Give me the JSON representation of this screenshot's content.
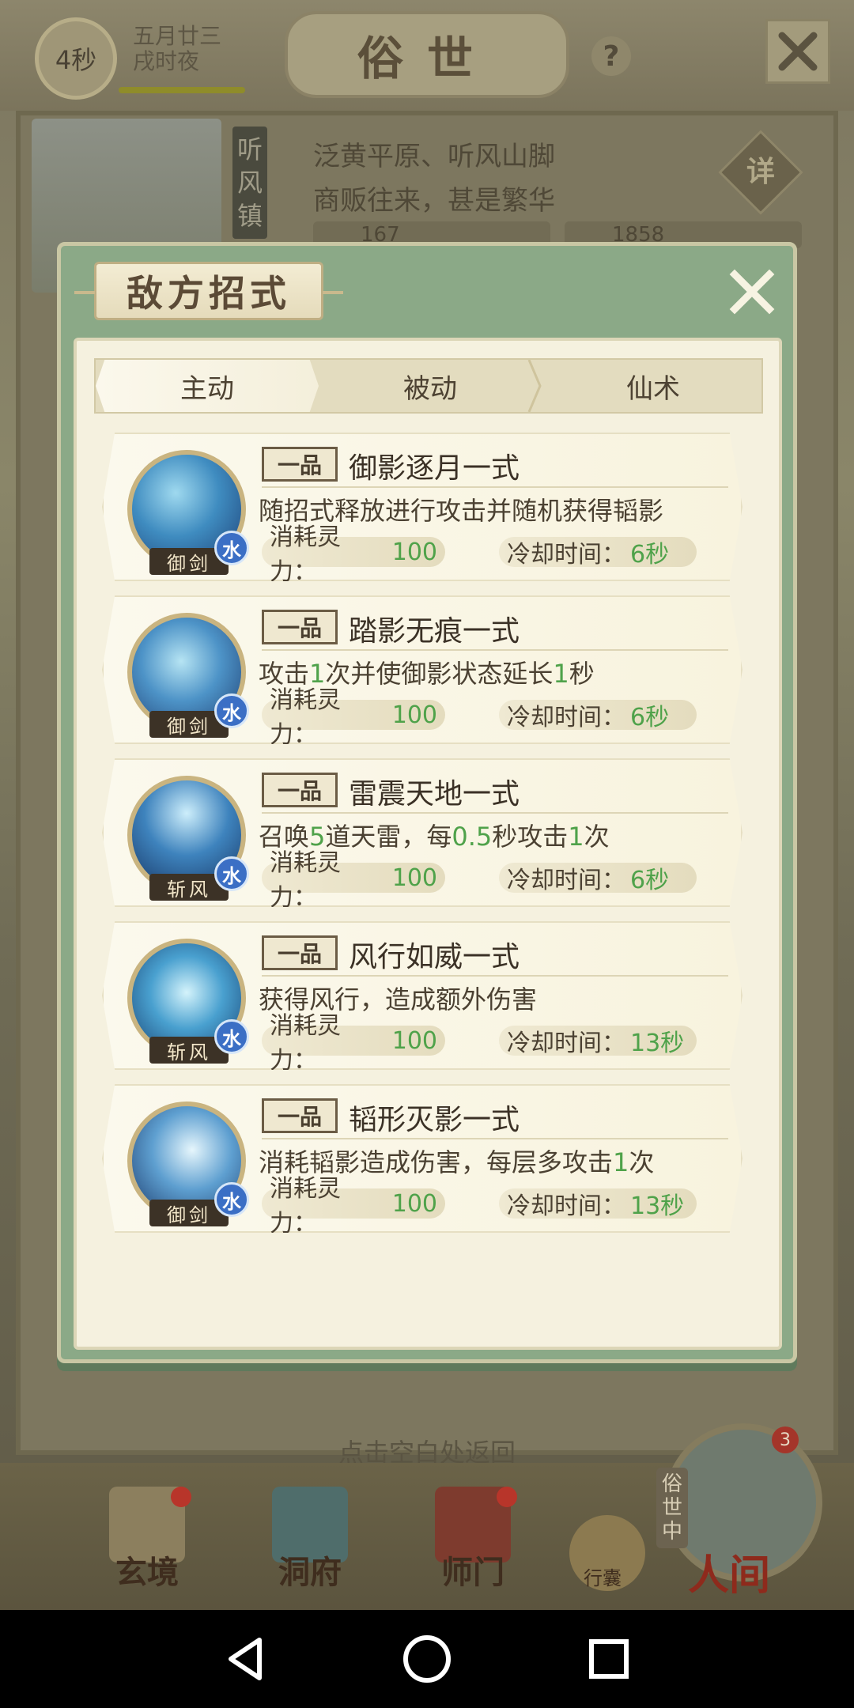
{
  "header": {
    "timer": "4秒",
    "date_line1": "五月廿三",
    "date_line2": "戌时夜",
    "title": "俗世",
    "help": "?"
  },
  "town": {
    "name": "听风镇",
    "desc_line1": "泛黄平原、听风山脚",
    "desc_line2": "商贩往来，甚是繁华",
    "detail": "详",
    "stat1": "167",
    "stat2": "1858"
  },
  "modal": {
    "title": "敌方招式",
    "tabs": [
      {
        "label": "主动",
        "active": true
      },
      {
        "label": "被动",
        "active": false
      },
      {
        "label": "仙术",
        "active": false
      }
    ],
    "cost_label": "消耗灵力：",
    "cd_label": "冷却时间：",
    "skills": [
      {
        "grade": "一品",
        "name": "御影逐月一式",
        "desc": [
          {
            "t": "随招式释放进行攻击并随机获得韬影",
            "n": false
          }
        ],
        "element": "水",
        "type": "御剑",
        "cost": "100",
        "cooldown": "6秒"
      },
      {
        "grade": "一品",
        "name": "踏影无痕一式",
        "desc": [
          {
            "t": "攻击",
            "n": false
          },
          {
            "t": "1",
            "n": true
          },
          {
            "t": "次并使御影状态延长",
            "n": false
          },
          {
            "t": "1",
            "n": true
          },
          {
            "t": "秒",
            "n": false
          }
        ],
        "element": "水",
        "type": "御剑",
        "cost": "100",
        "cooldown": "6秒"
      },
      {
        "grade": "一品",
        "name": "雷震天地一式",
        "desc": [
          {
            "t": "召唤",
            "n": false
          },
          {
            "t": "5",
            "n": true
          },
          {
            "t": "道天雷，每",
            "n": false
          },
          {
            "t": "0.5",
            "n": true
          },
          {
            "t": "秒攻击",
            "n": false
          },
          {
            "t": "1",
            "n": true
          },
          {
            "t": "次",
            "n": false
          }
        ],
        "element": "水",
        "type": "斩风",
        "cost": "100",
        "cooldown": "6秒"
      },
      {
        "grade": "一品",
        "name": "风行如威一式",
        "desc": [
          {
            "t": "获得风行，造成额外伤害",
            "n": false
          }
        ],
        "element": "水",
        "type": "斩风",
        "cost": "100",
        "cooldown": "13秒"
      },
      {
        "grade": "一品",
        "name": "韬形灭影一式",
        "desc": [
          {
            "t": "消耗韬影造成伤害，每层多攻击",
            "n": false
          },
          {
            "t": "1",
            "n": true
          },
          {
            "t": "次",
            "n": false
          }
        ],
        "element": "水",
        "type": "御剑",
        "cost": "100",
        "cooldown": "13秒"
      }
    ]
  },
  "hint": "点击空白处返回",
  "bottom_nav": {
    "items": [
      {
        "label": "玄境",
        "icon": "scroll-icon",
        "badge": true
      },
      {
        "label": "洞府",
        "icon": "pavilion-icon",
        "badge": false
      },
      {
        "label": "师门",
        "icon": "banner-icon",
        "badge": true
      }
    ],
    "bag_label": "行囊",
    "renjian_label": "人间",
    "renjian_tag": "俗世中",
    "renjian_badge": "3"
  },
  "colors": {
    "modal_frame": "#8ba987",
    "highlight_number": "#4fa24a",
    "element_badge": "#3b6fc5"
  }
}
